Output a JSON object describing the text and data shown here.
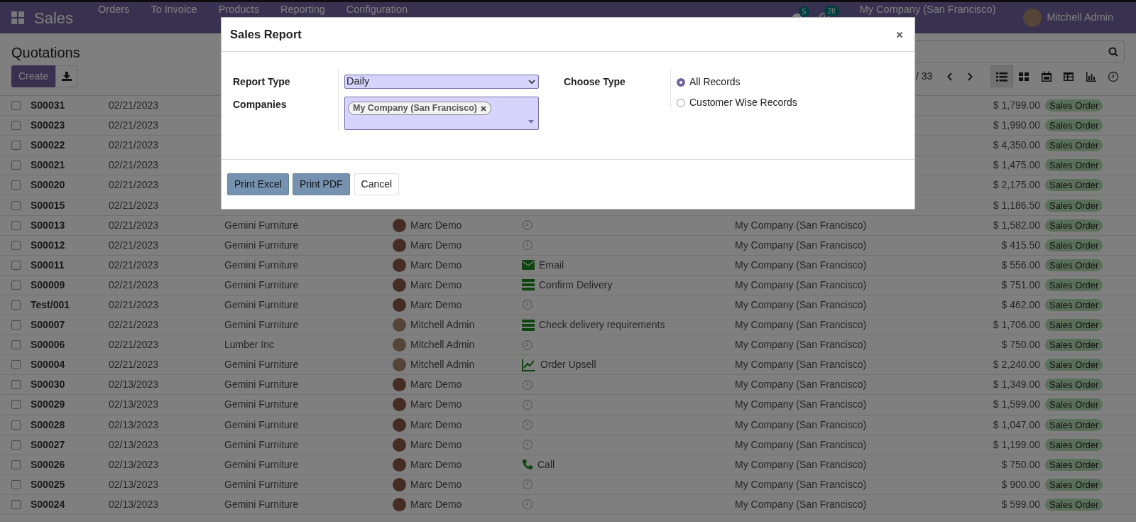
{
  "navbar": {
    "app": "Sales",
    "menu": [
      "Orders",
      "To Invoice",
      "Products",
      "Reporting",
      "Configuration"
    ],
    "messages_count": "5",
    "activities_count": "28",
    "company": "My Company (San Francisco)",
    "user": "Mitchell Admin"
  },
  "control_panel": {
    "title": "Quotations",
    "create": "Create",
    "pager": "/ 33",
    "views": [
      {
        "kind": "list",
        "selected": true
      },
      {
        "kind": "kanban",
        "selected": false
      },
      {
        "kind": "calendar",
        "selected": false
      },
      {
        "kind": "pivot",
        "selected": false
      },
      {
        "kind": "graph",
        "selected": false
      },
      {
        "kind": "activity",
        "selected": false
      }
    ]
  },
  "rows": [
    {
      "checked": false,
      "number": "S00031",
      "date": "02/21/2023",
      "amount": "$ 1,799.00",
      "status": "Sales Order"
    },
    {
      "checked": false,
      "number": "S00023",
      "date": "02/21/2023",
      "amount": "$ 1,990.00",
      "status": "Sales Order"
    },
    {
      "checked": false,
      "number": "S00022",
      "date": "02/21/2023",
      "amount": "$ 4,350.00",
      "status": "Sales Order"
    },
    {
      "checked": false,
      "number": "S00021",
      "date": "02/21/2023",
      "amount": "$ 1,475.00",
      "status": "Sales Order"
    },
    {
      "checked": false,
      "number": "S00020",
      "date": "02/21/2023",
      "amount": "$ 2,175.00",
      "status": "Sales Order"
    },
    {
      "checked": false,
      "number": "S00015",
      "date": "02/21/2023",
      "amount": "$ 1,186.50",
      "status": "Sales Order"
    },
    {
      "checked": false,
      "number": "S00013",
      "date": "02/21/2023",
      "customer": "Gemini Furniture",
      "salesperson": "Marc Demo",
      "activity": {
        "kind": "none"
      },
      "company": "My Company (San Francisco)",
      "amount": "$ 1,582.00",
      "status": "Sales Order"
    },
    {
      "checked": false,
      "number": "S00012",
      "date": "02/21/2023",
      "customer": "Gemini Furniture",
      "salesperson": "Marc Demo",
      "activity": {
        "kind": "none"
      },
      "company": "My Company (San Francisco)",
      "amount": "$ 415.50",
      "status": "Sales Order"
    },
    {
      "checked": false,
      "number": "S00011",
      "date": "02/21/2023",
      "customer": "Gemini Furniture",
      "salesperson": "Marc Demo",
      "activity": {
        "kind": "email",
        "overdue": false,
        "label": "Email"
      },
      "company": "My Company (San Francisco)",
      "amount": "$ 556.00",
      "status": "Sales Order"
    },
    {
      "checked": false,
      "number": "S00009",
      "date": "02/21/2023",
      "customer": "Gemini Furniture",
      "salesperson": "Marc Demo",
      "activity": {
        "kind": "todo",
        "overdue": false,
        "label": "Confirm Delivery"
      },
      "company": "My Company (San Francisco)",
      "amount": "$ 751.00",
      "status": "Sales Order"
    },
    {
      "checked": false,
      "number": "Test/001",
      "date": "02/21/2023",
      "customer": "Gemini Furniture",
      "salesperson": "Marc Demo",
      "activity": {
        "kind": "none"
      },
      "company": "My Company (San Francisco)",
      "amount": "$ 462.00",
      "status": "Sales Order"
    },
    {
      "checked": false,
      "number": "S00007",
      "date": "02/21/2023",
      "customer": "Gemini Furniture",
      "salesperson": "Mitchell Admin",
      "activity": {
        "kind": "todo",
        "overdue": false,
        "label": "Check delivery requirements"
      },
      "company": "My Company (San Francisco)",
      "amount": "$ 1,706.00",
      "status": "Sales Order"
    },
    {
      "checked": false,
      "number": "S00006",
      "date": "02/21/2023",
      "customer": "Lumber Inc",
      "salesperson": "Mitchell Admin",
      "activity": {
        "kind": "none"
      },
      "company": "My Company (San Francisco)",
      "amount": "$ 750.00",
      "status": "Sales Order"
    },
    {
      "checked": false,
      "number": "S00004",
      "date": "02/21/2023",
      "customer": "Gemini Furniture",
      "salesperson": "Mitchell Admin",
      "activity": {
        "kind": "upsell",
        "overdue": false,
        "label": "Order Upsell"
      },
      "company": "My Company (San Francisco)",
      "amount": "$ 2,240.00",
      "status": "Sales Order"
    },
    {
      "checked": false,
      "number": "S00030",
      "date": "02/13/2023",
      "customer": "Gemini Furniture",
      "salesperson": "Marc Demo",
      "activity": {
        "kind": "none"
      },
      "company": "My Company (San Francisco)",
      "amount": "$ 1,349.00",
      "status": "Sales Order"
    },
    {
      "checked": false,
      "number": "S00029",
      "date": "02/13/2023",
      "customer": "Gemini Furniture",
      "salesperson": "Marc Demo",
      "activity": {
        "kind": "none"
      },
      "company": "My Company (San Francisco)",
      "amount": "$ 1,599.00",
      "status": "Sales Order"
    },
    {
      "checked": false,
      "number": "S00028",
      "date": "02/13/2023",
      "customer": "Gemini Furniture",
      "salesperson": "Marc Demo",
      "activity": {
        "kind": "none"
      },
      "company": "My Company (San Francisco)",
      "amount": "$ 1,047.00",
      "status": "Sales Order"
    },
    {
      "checked": false,
      "number": "S00027",
      "date": "02/13/2023",
      "customer": "Gemini Furniture",
      "salesperson": "Marc Demo",
      "activity": {
        "kind": "none"
      },
      "company": "My Company (San Francisco)",
      "amount": "$ 1,199.00",
      "status": "Sales Order"
    },
    {
      "checked": false,
      "number": "S00026",
      "date": "02/13/2023",
      "customer": "Gemini Furniture",
      "salesperson": "Marc Demo",
      "activity": {
        "kind": "call",
        "overdue": false,
        "label": "Call"
      },
      "company": "My Company (San Francisco)",
      "amount": "$ 750.00",
      "status": "Sales Order"
    },
    {
      "checked": false,
      "number": "S00025",
      "date": "02/13/2023",
      "customer": "Gemini Furniture",
      "salesperson": "Marc Demo",
      "activity": {
        "kind": "none"
      },
      "company": "My Company (San Francisco)",
      "amount": "$ 900.00",
      "status": "Sales Order"
    },
    {
      "checked": false,
      "number": "S00024",
      "date": "02/13/2023",
      "customer": "Gemini Furniture",
      "salesperson": "Marc Demo",
      "activity": {
        "kind": "none"
      },
      "company": "My Company (San Francisco)",
      "amount": "$ 599.00",
      "status": "Sales Order"
    }
  ],
  "dialog": {
    "title": "Sales Report",
    "fields": [
      {
        "label": "Report Type",
        "kind": "select",
        "value": "Daily"
      },
      {
        "label": "Companies",
        "kind": "tags",
        "tags": [
          "My Company (San Francisco)"
        ]
      }
    ],
    "choose_type": {
      "label": "Choose Type",
      "options": [
        {
          "label": "All Records",
          "selected": true
        },
        {
          "label": "Customer Wise Records",
          "selected": false
        }
      ]
    },
    "buttons": [
      {
        "label": "Print Excel",
        "kind": "primary"
      },
      {
        "label": "Print PDF",
        "kind": "primary"
      },
      {
        "label": "Cancel",
        "kind": "secondary"
      }
    ]
  }
}
